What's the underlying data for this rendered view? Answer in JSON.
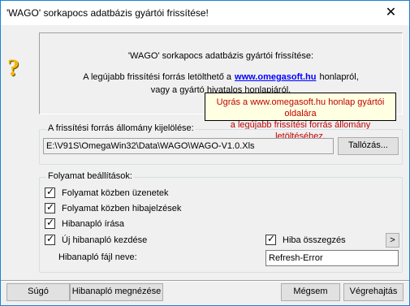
{
  "window": {
    "title": "'WAGO' sorkapocs adatbázis gyártói frissítése!",
    "close_label": "✕"
  },
  "icon": {
    "name": "question-mark-icon",
    "glyph": "?"
  },
  "info": {
    "title": "'WAGO' sorkapocs adatbázis gyártói frissítése:",
    "line1_before": "A legújabb frissítési forrás letölthető a",
    "link": "www.omegasoft.hu",
    "line1_after": "honlapról,",
    "line2": "vagy a gyártó hivatalos honlapjáról."
  },
  "tooltip": {
    "line1": "Ugrás a www.omegasoft.hu honlap gyártói oldalára",
    "line2": "a legújabb frissítési forrás állomány letöltéséhez."
  },
  "source_group": {
    "label": "A frissítési forrás állomány kijelölése:",
    "path": "E:\\V91S\\OmegaWin32\\Data\\WAGO\\WAGO-V1.0.Xls",
    "browse_label": "Tallózás..."
  },
  "process_group": {
    "label": "Folyamat beállítások:",
    "options": [
      {
        "label": "Folyamat közben üzenetek",
        "checked": true
      },
      {
        "label": "Folyamat közben hibajelzések",
        "checked": true
      },
      {
        "label": "Hibanapló írása",
        "checked": true
      },
      {
        "label": "Új hibanapló kezdése",
        "checked": true
      }
    ],
    "summary": {
      "label": "Hiba összegzés",
      "checked": true
    },
    "more_label": ">",
    "log_name_label": "Hibanapló fájl neve:",
    "log_name_value": "Refresh-Error"
  },
  "buttons": {
    "help": "Súgó",
    "view_log": "Hibanapló megnézése",
    "cancel": "Mégsem",
    "execute": "Végrehajtás"
  }
}
